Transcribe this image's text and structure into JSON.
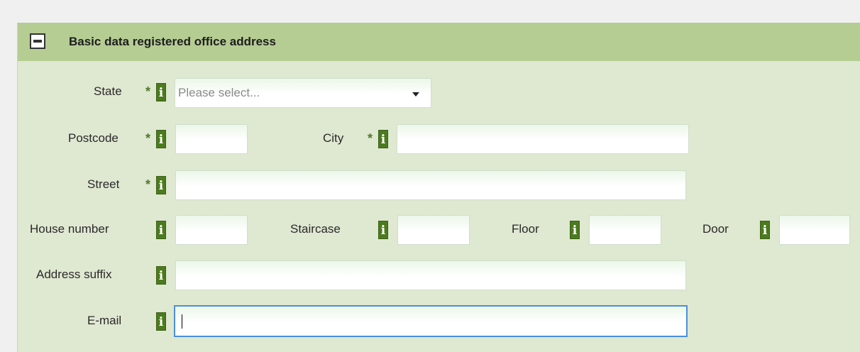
{
  "section": {
    "title": "Basic data registered office address",
    "collapse_icon": "minus-square-icon"
  },
  "fields": {
    "state": {
      "label": "State",
      "required": "*",
      "placeholder": "Please select...",
      "value": ""
    },
    "postcode": {
      "label": "Postcode",
      "required": "*",
      "value": ""
    },
    "city": {
      "label": "City",
      "required": "*",
      "value": ""
    },
    "street": {
      "label": "Street",
      "required": "*",
      "value": ""
    },
    "house_number": {
      "label": "House number",
      "value": ""
    },
    "staircase": {
      "label": "Staircase",
      "value": ""
    },
    "floor": {
      "label": "Floor",
      "value": ""
    },
    "door": {
      "label": "Door",
      "value": ""
    },
    "address_suffix": {
      "label": "Address suffix",
      "value": ""
    },
    "email": {
      "label": "E-mail",
      "value": ""
    }
  },
  "info_icon_text": "i",
  "colors": {
    "header_bg": "#b5cc93",
    "panel_bg": "#dfe8d1",
    "info_icon_bg": "#4c7a1f",
    "required_marker": "#4f7a2a",
    "focus_border": "#4a8fe0"
  }
}
